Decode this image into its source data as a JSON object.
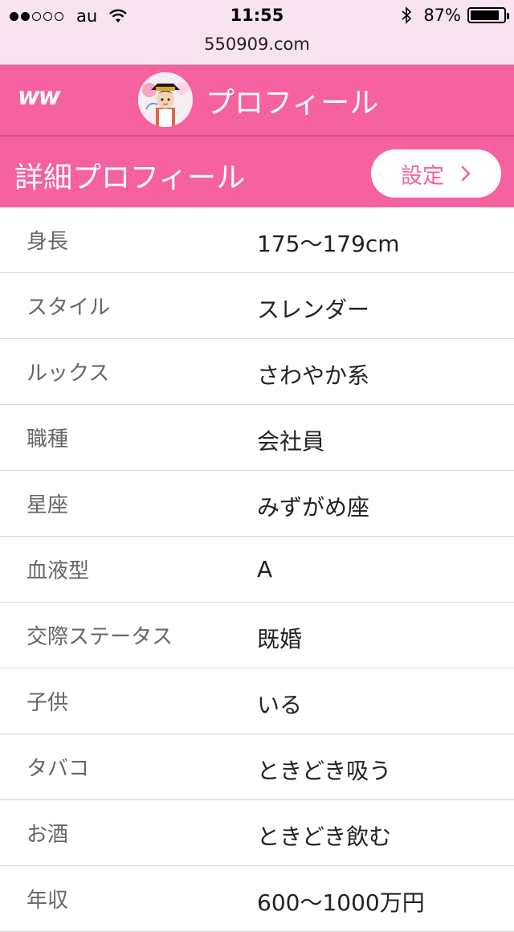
{
  "status_bar": {
    "carrier": "au",
    "time": "11:55",
    "battery": "87%",
    "battery_level": 0.87,
    "signal_bars_filled": 2,
    "signal_bars_total": 5
  },
  "browser": {
    "url": "550909.com"
  },
  "header": {
    "logo": "ww",
    "title": "プロフィール",
    "color": "#f661a0"
  },
  "section": {
    "title": "詳細プロフィール",
    "settings_label": "設定"
  },
  "profile": [
    {
      "label": "身長",
      "value": "175〜179cm"
    },
    {
      "label": "スタイル",
      "value": "スレンダー"
    },
    {
      "label": "ルックス",
      "value": "さわやか系"
    },
    {
      "label": "職種",
      "value": "会社員"
    },
    {
      "label": "星座",
      "value": "みずがめ座"
    },
    {
      "label": "血液型",
      "value": "A"
    },
    {
      "label": "交際ステータス",
      "value": "既婚"
    },
    {
      "label": "子供",
      "value": "いる"
    },
    {
      "label": "タバコ",
      "value": "ときどき吸う"
    },
    {
      "label": "お酒",
      "value": "ときどき飲む"
    },
    {
      "label": "年収",
      "value": "600〜1000万円"
    }
  ]
}
